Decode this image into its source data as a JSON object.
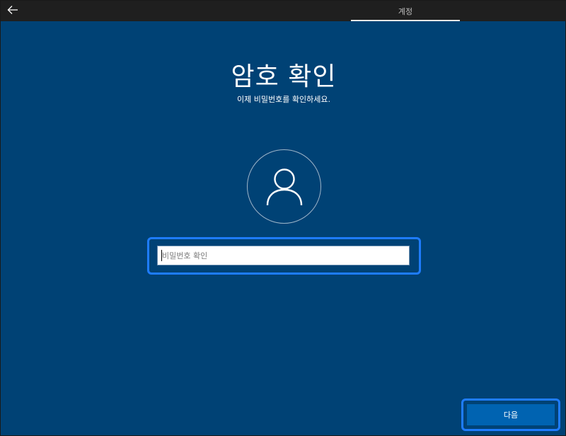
{
  "titlebar": {
    "back_icon": "back-arrow-icon",
    "active_tab": "계정"
  },
  "main": {
    "title": "암호 확인",
    "subtitle": "이제 비밀번호를 확인하세요.",
    "avatar_icon": "user-icon",
    "password_placeholder": "비밀번호 확인",
    "password_value": ""
  },
  "footer": {
    "next_label": "다음"
  },
  "colors": {
    "background": "#004275",
    "titlebar": "#1f1f1f",
    "focus_ring": "#1e7cff",
    "button": "#0063b1",
    "text": "#ffffff"
  }
}
